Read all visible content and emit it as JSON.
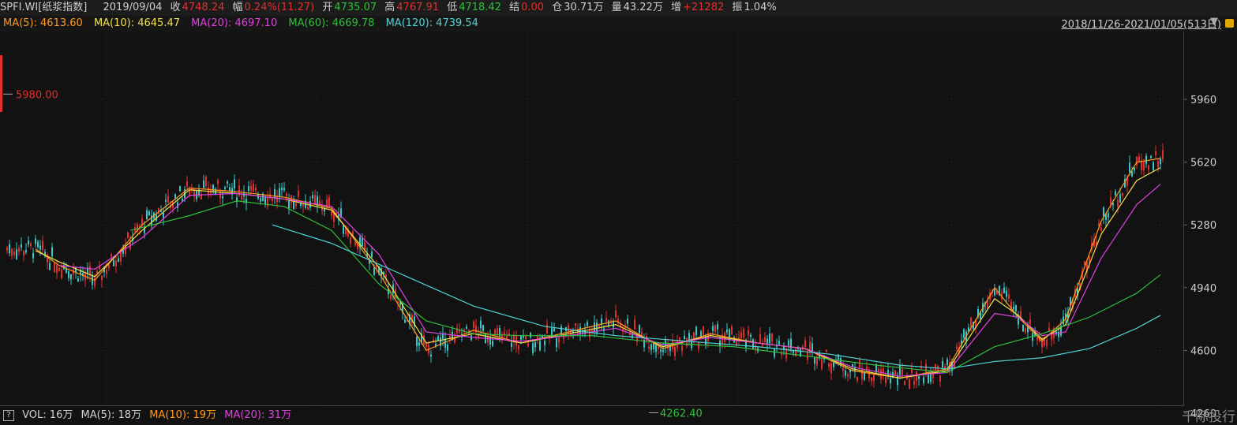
{
  "header": {
    "symbol": "SPFI.WI[纸浆指数]",
    "date": "2019/09/04",
    "close_label": "收",
    "close_value": "4748.24",
    "range_label": "幅",
    "range_value": "0.24%(11.27)",
    "open_label": "开",
    "open_value": "4735.07",
    "high_label": "高",
    "high_value": "4767.91",
    "low_label": "低",
    "low_value": "4718.42",
    "settle_label": "结",
    "settle_value": "0.00",
    "oi_label": "仓",
    "oi_value": "30.71万",
    "vol_label": "量",
    "vol_value": "43.22万",
    "inc_label": "增",
    "inc_value": "+21282",
    "amp_label": "振",
    "amp_value": "1.04%"
  },
  "ma": [
    {
      "label": "MA(5): 4613.60",
      "color": "#ff9a1f"
    },
    {
      "label": "MA(10): 4645.47",
      "color": "#f5e04a"
    },
    {
      "label": "MA(20): 4697.10",
      "color": "#e040e0"
    },
    {
      "label": "MA(60): 4669.78",
      "color": "#2fbf3a"
    },
    {
      "label": "MA(120): 4739.54",
      "color": "#4fd4d4"
    }
  ],
  "date_range": "2018/11/26-2021/01/05(513日)",
  "volume": {
    "label": "VOL: 16万",
    "ma5": "MA(5): 18万",
    "ma10": "MA(10): 19万",
    "ma20": "MA(20): 31万",
    "ma10_color": "#ff9a1f",
    "ma20_color": "#e040e0"
  },
  "watermark": "千际投行",
  "colors": {
    "up": "#e03030",
    "down": "#38c8c8",
    "grid": "#2a2a2a",
    "max_label": "#e03030",
    "min_label": "#2fbf3a"
  },
  "chart_data": {
    "type": "line",
    "title": "SPFI.WI[纸浆指数]",
    "y_ticks": [
      5960,
      5620,
      5280,
      4940,
      4600,
      4260
    ],
    "y_tick_labels": [
      "5960",
      "5620",
      "5280",
      "4940",
      "4600",
      "4260"
    ],
    "ylim": [
      4060,
      6000
    ],
    "x_range": [
      "2018/11/26",
      "2021/01/05"
    ],
    "max_marker": {
      "label": "5980.00",
      "value": 5980
    },
    "min_marker": {
      "label": "4262.40",
      "value": 4262.4
    },
    "series": [
      {
        "name": "MA(5)",
        "color": "#ff9a1f",
        "x": [
          0.03,
          0.05,
          0.08,
          0.12,
          0.16,
          0.2,
          0.24,
          0.28,
          0.32,
          0.36,
          0.4,
          0.44,
          0.48,
          0.52,
          0.56,
          0.6,
          0.64,
          0.68,
          0.72,
          0.76,
          0.8,
          0.84,
          0.86,
          0.88,
          0.9,
          0.93,
          0.96,
          0.98
        ],
        "values": [
          5150,
          5060,
          4980,
          5280,
          5480,
          5460,
          5430,
          5370,
          5020,
          4600,
          4710,
          4640,
          4700,
          4760,
          4610,
          4690,
          4640,
          4610,
          4490,
          4450,
          4500,
          4940,
          4780,
          4650,
          4770,
          5300,
          5620,
          5640
        ]
      },
      {
        "name": "MA(10)",
        "color": "#f5e04a",
        "x": [
          0.03,
          0.05,
          0.08,
          0.12,
          0.16,
          0.2,
          0.24,
          0.28,
          0.32,
          0.36,
          0.4,
          0.44,
          0.48,
          0.52,
          0.56,
          0.6,
          0.64,
          0.68,
          0.72,
          0.76,
          0.8,
          0.84,
          0.86,
          0.88,
          0.9,
          0.93,
          0.96,
          0.98
        ],
        "values": [
          5140,
          5080,
          5000,
          5250,
          5470,
          5450,
          5420,
          5360,
          5050,
          4640,
          4690,
          4640,
          4690,
          4740,
          4620,
          4680,
          4640,
          4610,
          4500,
          4450,
          4490,
          4880,
          4790,
          4660,
          4740,
          5230,
          5520,
          5590
        ]
      },
      {
        "name": "MA(20)",
        "color": "#e040e0",
        "x": [
          0.05,
          0.08,
          0.12,
          0.16,
          0.2,
          0.24,
          0.28,
          0.32,
          0.36,
          0.4,
          0.44,
          0.48,
          0.52,
          0.56,
          0.6,
          0.64,
          0.68,
          0.72,
          0.76,
          0.8,
          0.84,
          0.86,
          0.88,
          0.9,
          0.93,
          0.96,
          0.98
        ],
        "values": [
          5060,
          5040,
          5210,
          5440,
          5450,
          5420,
          5380,
          5120,
          4700,
          4670,
          4650,
          4680,
          4720,
          4630,
          4670,
          4640,
          4610,
          4510,
          4460,
          4480,
          4800,
          4780,
          4680,
          4700,
          5100,
          5390,
          5500
        ]
      },
      {
        "name": "MA(60)",
        "color": "#2fbf3a",
        "x": [
          0.11,
          0.16,
          0.2,
          0.24,
          0.28,
          0.32,
          0.36,
          0.4,
          0.44,
          0.5,
          0.56,
          0.62,
          0.68,
          0.74,
          0.8,
          0.84,
          0.88,
          0.92,
          0.96,
          0.98
        ],
        "values": [
          5250,
          5330,
          5410,
          5380,
          5250,
          4960,
          4760,
          4690,
          4680,
          4680,
          4640,
          4620,
          4570,
          4520,
          4480,
          4620,
          4690,
          4780,
          4910,
          5010
        ]
      },
      {
        "name": "MA(120)",
        "color": "#4fd4d4",
        "x": [
          0.23,
          0.28,
          0.34,
          0.4,
          0.46,
          0.52,
          0.58,
          0.64,
          0.7,
          0.76,
          0.8,
          0.84,
          0.88,
          0.92,
          0.96,
          0.98
        ],
        "values": [
          5280,
          5180,
          5010,
          4840,
          4730,
          4680,
          4650,
          4620,
          4580,
          4520,
          4500,
          4540,
          4560,
          4610,
          4720,
          4790
        ]
      }
    ]
  }
}
